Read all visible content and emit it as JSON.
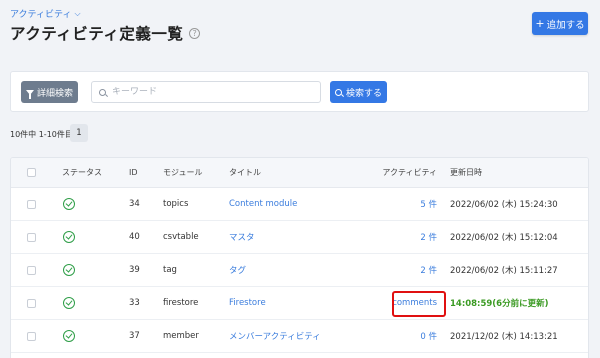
{
  "breadcrumb": {
    "label": "アクティビティ"
  },
  "page": {
    "title": "アクティビティ定義一覧"
  },
  "header": {
    "add_label": "追加する"
  },
  "search": {
    "advanced_label": "詳細検索",
    "placeholder": "キーワード",
    "value": "",
    "submit_label": "検索する"
  },
  "pagination": {
    "summary": "10件中 1-10件目",
    "current_page": "1"
  },
  "table": {
    "columns": [
      "ステータス",
      "ID",
      "モジュール",
      "タイトル",
      "アクティビティ",
      "更新日時"
    ],
    "rows": [
      {
        "id": "34",
        "module": "topics",
        "title": "Content module",
        "activity": "5 件",
        "updated": "2022/06/02 (木) 15:24:30"
      },
      {
        "id": "40",
        "module": "csvtable",
        "title": "マスタ",
        "activity": "2 件",
        "updated": "2022/06/02 (木) 15:12:04"
      },
      {
        "id": "39",
        "module": "tag",
        "title": "タグ",
        "activity": "2 件",
        "updated": "2022/06/02 (木) 15:11:27"
      },
      {
        "id": "33",
        "module": "firestore",
        "title": "Firestore",
        "activity": "comments",
        "updated": "14:08:59(6分前に更新)"
      },
      {
        "id": "37",
        "module": "member",
        "title": "メンバーアクティビティ",
        "activity": "0 件",
        "updated": "2021/12/02 (木) 14:13:21"
      }
    ]
  },
  "colors": {
    "accent": "#3478e5",
    "status_ok": "#2f9e48",
    "highlight": "#e01010",
    "recent_update": "#3a9a22"
  },
  "icons": {
    "status": "check-circle-icon",
    "filter": "filter-icon",
    "search": "search-icon",
    "help": "help-icon"
  }
}
